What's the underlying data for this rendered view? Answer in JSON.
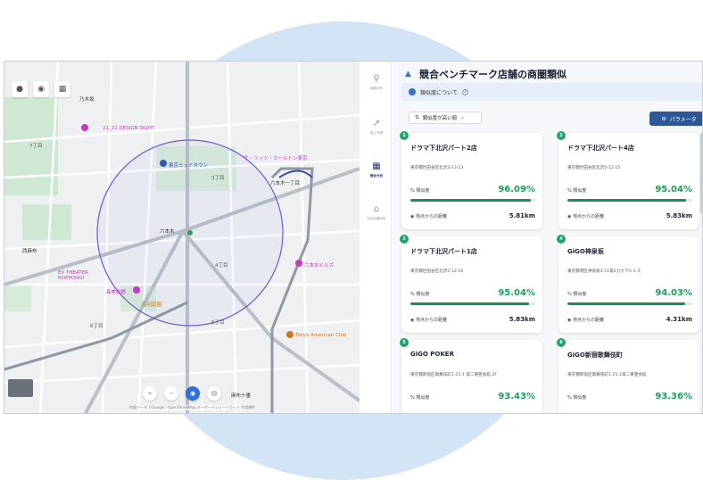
{
  "map": {
    "labels": {
      "nogizaka": "乃木坂",
      "design_sight": "21_21 DESIGN SIGHT",
      "nishiazabu": "西麻布",
      "midtown": "東京ミッドタウン",
      "ritz": "ザ・リッツ・カールトン東京",
      "roppongi": "六本木",
      "roppongi_1": "六本木一丁目",
      "roppongi_hills": "六本木ヒルズ",
      "mori_museum": "森美術館",
      "ex_theater": "EX THEATER ROPPONGI",
      "mouri_garden": "毛利庭園",
      "tokyo_american_club": "Tokyo American Club",
      "azabu_juban": "麻布十番",
      "chome7": "7丁目",
      "chome3": "3丁目",
      "chome4": "4丁目",
      "chome5": "5丁目",
      "chome6": "6丁目"
    },
    "attribution": "地図データ ©Google / OpenStreetMap  キーボードショートカット  利用規約"
  },
  "nav": {
    "items": [
      {
        "label": "地域分析",
        "icon": "pin-icon"
      },
      {
        "label": "売上予測",
        "icon": "chart-icon"
      },
      {
        "label": "競合分析",
        "icon": "building-icon"
      },
      {
        "label": "自社店舗分析",
        "icon": "store-icon"
      }
    ]
  },
  "panel": {
    "title": "競合ベンチマーク店舗の商圏類似",
    "info": "類似度について",
    "sort_label": "類似度が高い順",
    "param_label": "パラメータ",
    "similarity_label": "類似度",
    "distance_label": "地点からの距離",
    "cards": [
      {
        "rank": "1",
        "name": "ドラマ下北沢パート2店",
        "address": "東京都世田谷区北沢2-13-13",
        "similarity": "96.09%",
        "similarity_value": 96.09,
        "distance": "5.81km"
      },
      {
        "rank": "2",
        "name": "ドラマ下北沢パート4店",
        "address": "東京都世田谷区北沢2-12-15",
        "similarity": "95.04%",
        "similarity_value": 95.04,
        "distance": "5.83km"
      },
      {
        "rank": "3",
        "name": "ドラマ下北沢パート1店",
        "address": "東京都世田谷区北沢2-12-16",
        "similarity": "95.04%",
        "similarity_value": 95.04,
        "distance": "5.83km"
      },
      {
        "rank": "4",
        "name": "GiGO神泉坂",
        "address": "東京都港区神泉坂2-11第2カグラヒルズ",
        "similarity": "94.03%",
        "similarity_value": 94.03,
        "distance": "4.31km"
      },
      {
        "rank": "5",
        "name": "GiGO POKER",
        "address": "東京都新宿区歌舞伎町1-21-1 第二東亜会館 2F",
        "similarity": "93.43%",
        "similarity_value": 93.43,
        "distance": ""
      },
      {
        "rank": "6",
        "name": "GiGO新宿歌舞伎町",
        "address": "東京都新宿区歌舞伎町1-21-1第二東亜会館",
        "similarity": "93.36%",
        "similarity_value": 93.36,
        "distance": ""
      }
    ]
  },
  "colors": {
    "accent": "#2e5797",
    "similarity": "#1b9e5a",
    "badge": "#20a46a",
    "circle": "#6b5bd6"
  }
}
